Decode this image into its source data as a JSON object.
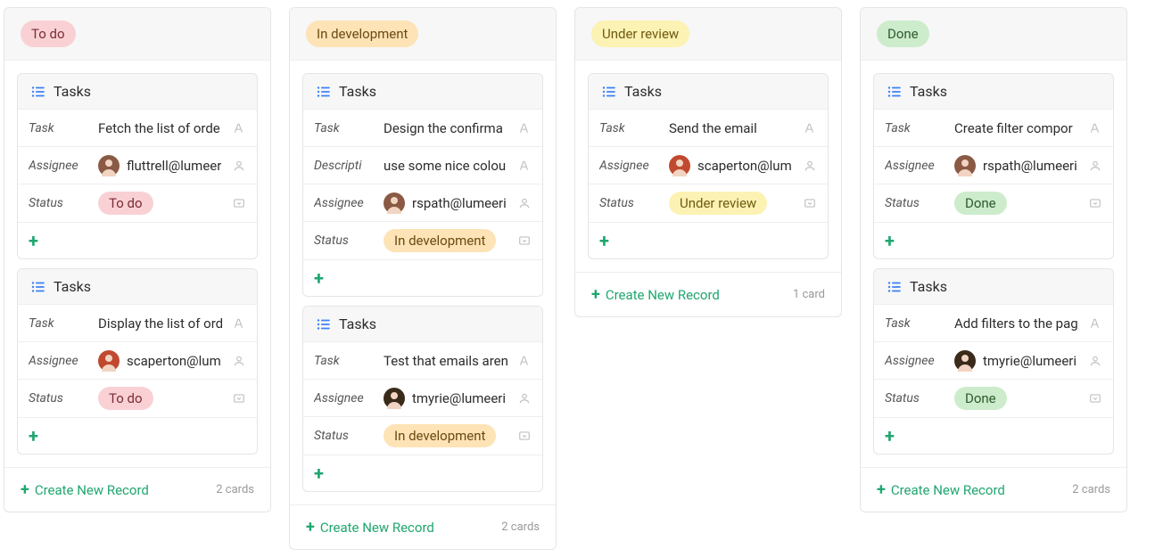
{
  "labels": {
    "task": "Task",
    "description": "Descripti",
    "assignee": "Assignee",
    "status": "Status",
    "tasks_header": "Tasks",
    "create_new": "Create New Record"
  },
  "status_colors": {
    "To do": {
      "bg": "#f9d1d5",
      "fg": "#7a2b34"
    },
    "In development": {
      "bg": "#fde3b5",
      "fg": "#6b4a12"
    },
    "Under review": {
      "bg": "#fcf2b3",
      "fg": "#6e5b10"
    },
    "Done": {
      "bg": "#cdeccc",
      "fg": "#2d5a2c"
    }
  },
  "avatar_colors": {
    "fluttrell@lumeer": "#8a5a44",
    "scaperton@lum": "#c04a2f",
    "rspath@lumeeri": "#8a5a44",
    "tmyrie@lumeeri": "#3a2a1a"
  },
  "columns": [
    {
      "title": "To do",
      "count": "2 cards",
      "cards": [
        {
          "rows": [
            {
              "label": "task",
              "type": "text",
              "value": "Fetch the list of orde"
            },
            {
              "label": "assignee",
              "type": "user",
              "value": "fluttrell@lumeer"
            },
            {
              "label": "status",
              "type": "select",
              "value": "To do"
            }
          ]
        },
        {
          "rows": [
            {
              "label": "task",
              "type": "text",
              "value": "Display the list of ord"
            },
            {
              "label": "assignee",
              "type": "user",
              "value": "scaperton@lum"
            },
            {
              "label": "status",
              "type": "select",
              "value": "To do"
            }
          ]
        }
      ]
    },
    {
      "title": "In development",
      "count": "2 cards",
      "cards": [
        {
          "rows": [
            {
              "label": "task",
              "type": "text",
              "value": "Design the confirma"
            },
            {
              "label": "description",
              "type": "text",
              "value": "use some nice colou"
            },
            {
              "label": "assignee",
              "type": "user",
              "value": "rspath@lumeeri"
            },
            {
              "label": "status",
              "type": "select",
              "value": "In development"
            }
          ]
        },
        {
          "rows": [
            {
              "label": "task",
              "type": "text",
              "value": "Test that emails aren"
            },
            {
              "label": "assignee",
              "type": "user",
              "value": "tmyrie@lumeeri"
            },
            {
              "label": "status",
              "type": "select",
              "value": "In development"
            }
          ]
        }
      ]
    },
    {
      "title": "Under review",
      "count": "1 card",
      "cards": [
        {
          "rows": [
            {
              "label": "task",
              "type": "text",
              "value": "Send the email"
            },
            {
              "label": "assignee",
              "type": "user",
              "value": "scaperton@lum"
            },
            {
              "label": "status",
              "type": "select",
              "value": "Under review"
            }
          ]
        }
      ]
    },
    {
      "title": "Done",
      "count": "2 cards",
      "cards": [
        {
          "rows": [
            {
              "label": "task",
              "type": "text",
              "value": "Create filter compor"
            },
            {
              "label": "assignee",
              "type": "user",
              "value": "rspath@lumeeri"
            },
            {
              "label": "status",
              "type": "select",
              "value": "Done"
            }
          ]
        },
        {
          "rows": [
            {
              "label": "task",
              "type": "text",
              "value": "Add filters to the pag"
            },
            {
              "label": "assignee",
              "type": "user",
              "value": "tmyrie@lumeeri"
            },
            {
              "label": "status",
              "type": "select",
              "value": "Done"
            }
          ]
        }
      ]
    }
  ]
}
